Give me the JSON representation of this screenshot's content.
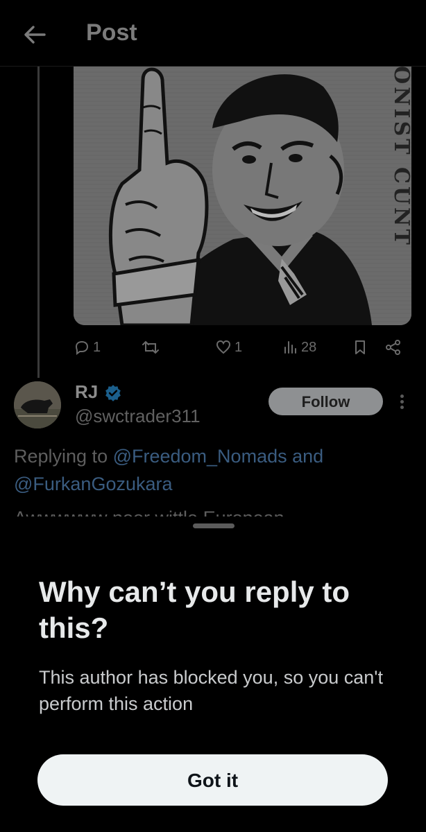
{
  "header": {
    "title": "Post"
  },
  "media": {
    "stamp_text": "ONIST CUNT"
  },
  "actions": {
    "replies": "1",
    "reposts": "",
    "likes": "1",
    "views": "28"
  },
  "reply": {
    "name": "RJ",
    "handle": "@swctrader311",
    "follow_label": "Follow",
    "replying_prefix": "Replying to ",
    "mention_1": "@Freedom_Nomads",
    "conjunction": " and",
    "mention_2": "@FurkanGozukara",
    "truncated_text": "Awwwwww poor wittle European"
  },
  "sheet": {
    "title": "Why can’t you reply to this?",
    "body": "This author has blocked you, so you can't perform this action",
    "button_label": "Got it"
  },
  "colors": {
    "background": "#000000",
    "accent_link": "#1d9bf0",
    "verified": "#1d9bf0",
    "button_bg": "#eff3f4"
  }
}
